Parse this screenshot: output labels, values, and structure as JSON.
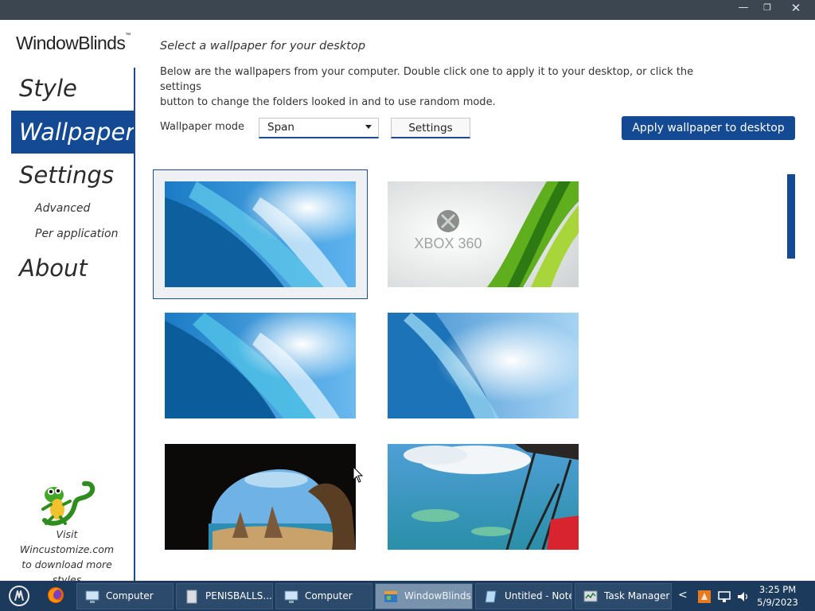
{
  "window": {
    "minimize_glyph": "—",
    "maximize_glyph": "❐",
    "close_glyph": "✕"
  },
  "sidebar": {
    "logo": "WindowBlinds",
    "logo_mark": "™",
    "nav": [
      {
        "label": "Style",
        "active": false
      },
      {
        "label": "Wallpaper",
        "active": true
      },
      {
        "label": "Settings",
        "active": false
      }
    ],
    "subnav": [
      "Advanced",
      "Per application"
    ],
    "about": "About",
    "promo_line1": "Visit Wincustomize.com",
    "promo_line2": "to download more",
    "promo_line3": "styles",
    "mascot_icon": "gecko-icon"
  },
  "main": {
    "heading": "Select a wallpaper for your desktop",
    "description_line1": "Below are the wallpapers from your computer.  Double click one to apply it to your desktop, or click the settings",
    "description_line2": "button to change the folders looked in and to use random mode.",
    "mode_label": "Wallpaper mode",
    "mode_value": "Span",
    "settings_button": "Settings",
    "apply_button": "Apply wallpaper to desktop",
    "wallpapers": [
      {
        "name": "wave-1",
        "selected": true
      },
      {
        "name": "xbox-360",
        "text": "XBOX 360",
        "selected": false
      },
      {
        "name": "wave-2",
        "selected": false
      },
      {
        "name": "wave-3",
        "selected": false
      },
      {
        "name": "cave-beach",
        "selected": false
      },
      {
        "name": "aerial-ocean",
        "selected": false
      }
    ]
  },
  "taskbar": {
    "start_icon": "start-orb-icon",
    "pinned_icon": "firefox-icon",
    "items": [
      {
        "label": "Computer",
        "icon": "computer-icon",
        "active": false
      },
      {
        "label": "PENISBALLS....",
        "icon": "document-icon",
        "active": false
      },
      {
        "label": "Computer",
        "icon": "computer-icon",
        "active": false
      },
      {
        "label": "WindowBlinds ...",
        "icon": "windowblinds-icon",
        "active": true
      },
      {
        "label": "Untitled - Note...",
        "icon": "notepad-icon",
        "active": false
      },
      {
        "label": "Task Manager",
        "icon": "task-manager-icon",
        "active": false
      }
    ],
    "tray_arrow": "<",
    "time": "3:25 PM",
    "date": "5/9/2023"
  },
  "colors": {
    "accent": "#134a93",
    "titlebar": "#3b4651",
    "taskbar": "#1b3a5c"
  }
}
